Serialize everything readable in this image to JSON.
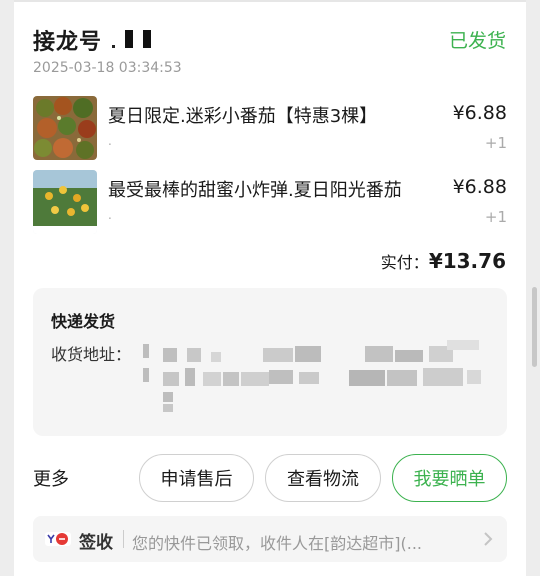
{
  "order": {
    "title": "接龙号",
    "status": "已发货",
    "time": "2025-03-18 03:34:53"
  },
  "items": [
    {
      "name": "夏日限定.迷彩小番茄【特惠3棵】",
      "spec": ".",
      "price": "¥6.88",
      "qty": "+1"
    },
    {
      "name": "最受最棒的甜蜜小炸弹.夏日阳光番茄",
      "spec": ".",
      "price": "¥6.88",
      "qty": "+1"
    }
  ],
  "payment": {
    "label": "实付：",
    "amount": "¥13.76"
  },
  "shipping": {
    "title": "快递发货",
    "address_label": "收货地址："
  },
  "actions": {
    "more": "更多",
    "after_sale": "申请售后",
    "logistics": "查看物流",
    "share": "我要晒单"
  },
  "tracking": {
    "status": "签收",
    "message": "您的快件已领取，收件人在[韵达超市](..."
  },
  "colors": {
    "accent": "#3cb24f"
  }
}
